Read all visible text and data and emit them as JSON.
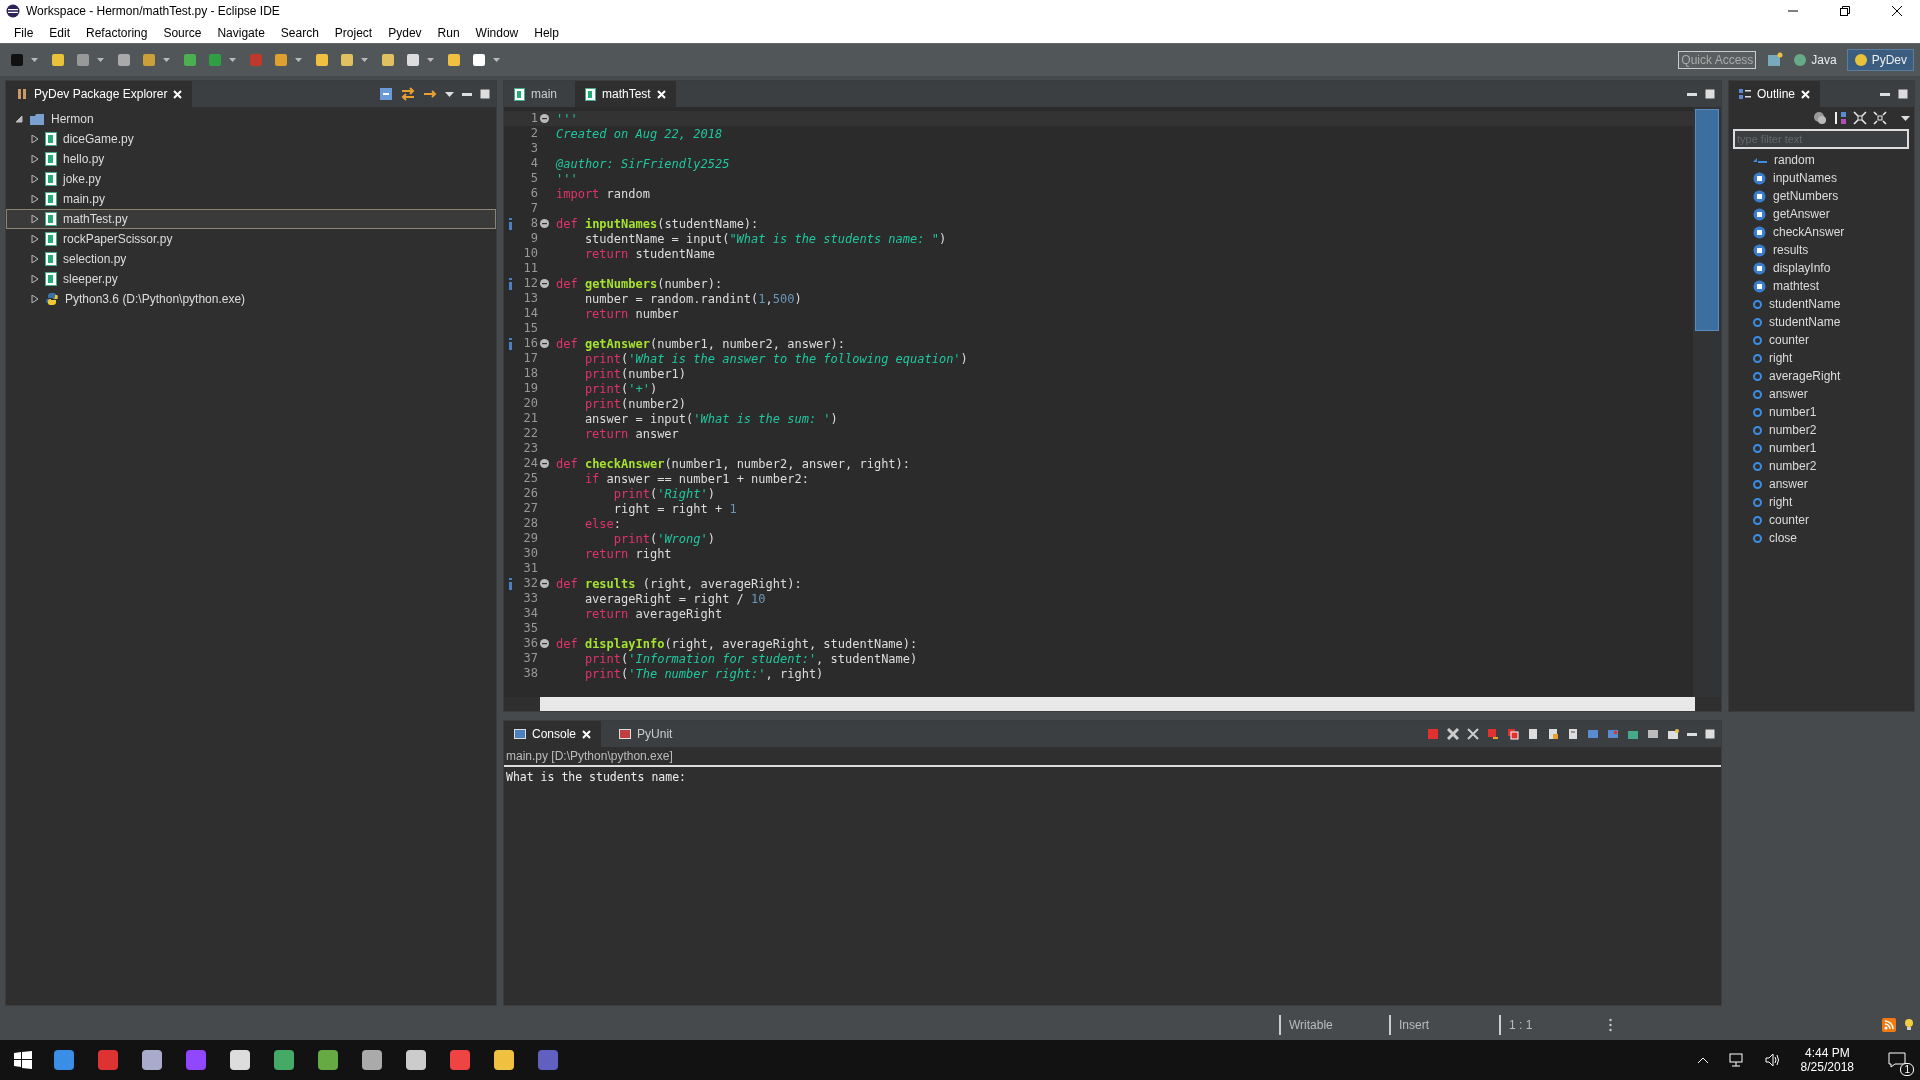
{
  "window": {
    "title": "Workspace - Hermon/mathTest.py - Eclipse IDE"
  },
  "menu": [
    "File",
    "Edit",
    "Refactoring",
    "Source",
    "Navigate",
    "Search",
    "Project",
    "Pydev",
    "Run",
    "Window",
    "Help"
  ],
  "toolbar": {
    "quick_access": {
      "placeholder": "Quick Access"
    },
    "perspectives": [
      {
        "label": "Java",
        "selected": false
      },
      {
        "label": "PyDev",
        "selected": true
      }
    ]
  },
  "explorer": {
    "title": "PyDev Package Explorer",
    "tree": [
      {
        "label": "Hermon",
        "kind": "project",
        "expanded": true,
        "selected": false,
        "children": [
          {
            "label": "diceGame.py",
            "kind": "file",
            "expanded": false,
            "selected": false
          },
          {
            "label": "hello.py",
            "kind": "file",
            "expanded": false,
            "selected": false
          },
          {
            "label": "joke.py",
            "kind": "file",
            "expanded": false,
            "selected": false
          },
          {
            "label": "main.py",
            "kind": "file",
            "expanded": false,
            "selected": false
          },
          {
            "label": "mathTest.py",
            "kind": "file",
            "expanded": false,
            "selected": true
          },
          {
            "label": "rockPaperScissor.py",
            "kind": "file",
            "expanded": false,
            "selected": false
          },
          {
            "label": "selection.py",
            "kind": "file",
            "expanded": false,
            "selected": false
          },
          {
            "label": "sleeper.py",
            "kind": "file",
            "expanded": false,
            "selected": false
          },
          {
            "label": "Python3.6  (D:\\Python\\python.exe)",
            "kind": "interpreter",
            "expanded": false,
            "selected": false
          }
        ]
      }
    ]
  },
  "editor": {
    "tabs": [
      {
        "label": "main",
        "selected": false
      },
      {
        "label": "mathTest",
        "selected": true
      }
    ],
    "lines": [
      {
        "number": "1",
        "info": false,
        "fold": true,
        "tokens": [
          {
            "kind": "str",
            "text": "'''"
          }
        ]
      },
      {
        "number": "2",
        "info": false,
        "fold": false,
        "tokens": [
          {
            "kind": "str",
            "text": "Created on Aug 22, 2018"
          }
        ]
      },
      {
        "number": "3",
        "info": false,
        "fold": false
      },
      {
        "number": "4",
        "info": false,
        "fold": false,
        "tokens": [
          {
            "kind": "str",
            "text": "@author: SirFriendly2525"
          }
        ]
      },
      {
        "number": "5",
        "info": false,
        "fold": false,
        "tokens": [
          {
            "kind": "str",
            "text": "'''"
          }
        ]
      },
      {
        "number": "6",
        "info": false,
        "fold": false,
        "tokens": [
          {
            "kind": "kw",
            "text": "import"
          },
          {
            "kind": "plain",
            "text": " random"
          }
        ]
      },
      {
        "number": "7",
        "info": false,
        "fold": false
      },
      {
        "number": "8",
        "info": true,
        "fold": true,
        "tokens": [
          {
            "kind": "kw",
            "text": "def "
          },
          {
            "kind": "fn",
            "text": "inputNames"
          },
          {
            "kind": "plain",
            "text": "(studentName):"
          }
        ]
      },
      {
        "number": "9",
        "info": false,
        "fold": false,
        "tokens": [
          {
            "kind": "plain",
            "text": "    studentName = input("
          },
          {
            "kind": "str",
            "text": "\"What is the students name: \""
          },
          {
            "kind": "plain",
            "text": ")"
          }
        ]
      },
      {
        "number": "10",
        "info": false,
        "fold": false,
        "tokens": [
          {
            "kind": "kw",
            "text": "    return"
          },
          {
            "kind": "plain",
            "text": " studentName"
          }
        ]
      },
      {
        "number": "11",
        "info": false,
        "fold": false
      },
      {
        "number": "12",
        "info": true,
        "fold": true,
        "tokens": [
          {
            "kind": "kw",
            "text": "def "
          },
          {
            "kind": "fn",
            "text": "getNumbers"
          },
          {
            "kind": "plain",
            "text": "(number):"
          }
        ]
      },
      {
        "number": "13",
        "info": false,
        "fold": false,
        "tokens": [
          {
            "kind": "plain",
            "text": "    number = random.randint("
          },
          {
            "kind": "num",
            "text": "1"
          },
          {
            "kind": "plain",
            "text": ","
          },
          {
            "kind": "num",
            "text": "500"
          },
          {
            "kind": "plain",
            "text": ")"
          }
        ]
      },
      {
        "number": "14",
        "info": false,
        "fold": false,
        "tokens": [
          {
            "kind": "kw",
            "text": "    return"
          },
          {
            "kind": "plain",
            "text": " number"
          }
        ]
      },
      {
        "number": "15",
        "info": false,
        "fold": false
      },
      {
        "number": "16",
        "info": true,
        "fold": true,
        "tokens": [
          {
            "kind": "kw",
            "text": "def "
          },
          {
            "kind": "fn",
            "text": "getAnswer"
          },
          {
            "kind": "plain",
            "text": "(number1, number2, answer):"
          }
        ]
      },
      {
        "number": "17",
        "info": false,
        "fold": false,
        "tokens": [
          {
            "kind": "kw",
            "text": "    print"
          },
          {
            "kind": "plain",
            "text": "("
          },
          {
            "kind": "str",
            "text": "'What is the answer to the following equation'"
          },
          {
            "kind": "plain",
            "text": ")"
          }
        ]
      },
      {
        "number": "18",
        "info": false,
        "fold": false,
        "tokens": [
          {
            "kind": "kw",
            "text": "    print"
          },
          {
            "kind": "plain",
            "text": "(number1)"
          }
        ]
      },
      {
        "number": "19",
        "info": false,
        "fold": false,
        "tokens": [
          {
            "kind": "kw",
            "text": "    print"
          },
          {
            "kind": "plain",
            "text": "("
          },
          {
            "kind": "str",
            "text": "'+'"
          },
          {
            "kind": "plain",
            "text": ")"
          }
        ]
      },
      {
        "number": "20",
        "info": false,
        "fold": false,
        "tokens": [
          {
            "kind": "kw",
            "text": "    print"
          },
          {
            "kind": "plain",
            "text": "(number2)"
          }
        ]
      },
      {
        "number": "21",
        "info": false,
        "fold": false,
        "tokens": [
          {
            "kind": "plain",
            "text": "    answer = input("
          },
          {
            "kind": "str",
            "text": "'What is the sum: '"
          },
          {
            "kind": "plain",
            "text": ")"
          }
        ]
      },
      {
        "number": "22",
        "info": false,
        "fold": false,
        "tokens": [
          {
            "kind": "kw",
            "text": "    return"
          },
          {
            "kind": "plain",
            "text": " answer"
          }
        ]
      },
      {
        "number": "23",
        "info": false,
        "fold": false
      },
      {
        "number": "24",
        "info": false,
        "fold": true,
        "tokens": [
          {
            "kind": "kw",
            "text": "def "
          },
          {
            "kind": "fn",
            "text": "checkAnswer"
          },
          {
            "kind": "plain",
            "text": "(number1, number2, answer, right):"
          }
        ]
      },
      {
        "number": "25",
        "info": false,
        "fold": false,
        "tokens": [
          {
            "kind": "kw",
            "text": "    if"
          },
          {
            "kind": "plain",
            "text": " answer == number1 + number2:"
          }
        ]
      },
      {
        "number": "26",
        "info": false,
        "fold": false,
        "tokens": [
          {
            "kind": "kw",
            "text": "        print"
          },
          {
            "kind": "plain",
            "text": "("
          },
          {
            "kind": "str",
            "text": "'Right'"
          },
          {
            "kind": "plain",
            "text": ")"
          }
        ]
      },
      {
        "number": "27",
        "info": false,
        "fold": false,
        "tokens": [
          {
            "kind": "plain",
            "text": "        right = right + "
          },
          {
            "kind": "num",
            "text": "1"
          }
        ]
      },
      {
        "number": "28",
        "info": false,
        "fold": false,
        "tokens": [
          {
            "kind": "kw",
            "text": "    else"
          },
          {
            "kind": "plain",
            "text": ":"
          }
        ]
      },
      {
        "number": "29",
        "info": false,
        "fold": false,
        "tokens": [
          {
            "kind": "kw",
            "text": "        print"
          },
          {
            "kind": "plain",
            "text": "("
          },
          {
            "kind": "str",
            "text": "'Wrong'"
          },
          {
            "kind": "plain",
            "text": ")"
          }
        ]
      },
      {
        "number": "30",
        "info": false,
        "fold": false,
        "tokens": [
          {
            "kind": "kw",
            "text": "    return"
          },
          {
            "kind": "plain",
            "text": " right"
          }
        ]
      },
      {
        "number": "31",
        "info": false,
        "fold": false
      },
      {
        "number": "32",
        "info": true,
        "fold": true,
        "tokens": [
          {
            "kind": "kw",
            "text": "def "
          },
          {
            "kind": "fn",
            "text": "results"
          },
          {
            "kind": "plain",
            "text": " (right, averageRight):"
          }
        ]
      },
      {
        "number": "33",
        "info": false,
        "fold": false,
        "tokens": [
          {
            "kind": "plain",
            "text": "    averageRight = right / "
          },
          {
            "kind": "num",
            "text": "10"
          }
        ]
      },
      {
        "number": "34",
        "info": false,
        "fold": false,
        "tokens": [
          {
            "kind": "kw",
            "text": "    return"
          },
          {
            "kind": "plain",
            "text": " averageRight"
          }
        ]
      },
      {
        "number": "35",
        "info": false,
        "fold": false
      },
      {
        "number": "36",
        "info": false,
        "fold": true,
        "tokens": [
          {
            "kind": "kw",
            "text": "def "
          },
          {
            "kind": "fn",
            "text": "displayInfo"
          },
          {
            "kind": "plain",
            "text": "(right, averageRight, studentName):"
          }
        ]
      },
      {
        "number": "37",
        "info": false,
        "fold": false,
        "tokens": [
          {
            "kind": "kw",
            "text": "    print"
          },
          {
            "kind": "plain",
            "text": "("
          },
          {
            "kind": "str",
            "text": "'Information for student:'"
          },
          {
            "kind": "plain",
            "text": ", studentName)"
          }
        ]
      },
      {
        "number": "38",
        "info": false,
        "fold": false,
        "tokens": [
          {
            "kind": "kw",
            "text": "    print"
          },
          {
            "kind": "plain",
            "text": "("
          },
          {
            "kind": "str",
            "text": "'The number right:'"
          },
          {
            "kind": "plain",
            "text": ", right)"
          }
        ]
      }
    ]
  },
  "outline": {
    "title": "Outline",
    "filter": {
      "placeholder": "type filter text"
    },
    "items": [
      {
        "label": "random",
        "kind": "import"
      },
      {
        "label": "inputNames",
        "kind": "method"
      },
      {
        "label": "getNumbers",
        "kind": "method"
      },
      {
        "label": "getAnswer",
        "kind": "method"
      },
      {
        "label": "checkAnswer",
        "kind": "method"
      },
      {
        "label": "results",
        "kind": "method"
      },
      {
        "label": "displayInfo",
        "kind": "method"
      },
      {
        "label": "mathtest",
        "kind": "method"
      },
      {
        "label": "studentName",
        "kind": "attribute"
      },
      {
        "label": "studentName",
        "kind": "attribute"
      },
      {
        "label": "counter",
        "kind": "attribute"
      },
      {
        "label": "right",
        "kind": "attribute"
      },
      {
        "label": "averageRight",
        "kind": "attribute"
      },
      {
        "label": "answer",
        "kind": "attribute"
      },
      {
        "label": "number1",
        "kind": "attribute"
      },
      {
        "label": "number2",
        "kind": "attribute"
      },
      {
        "label": "number1",
        "kind": "attribute"
      },
      {
        "label": "number2",
        "kind": "attribute"
      },
      {
        "label": "answer",
        "kind": "attribute"
      },
      {
        "label": "right",
        "kind": "attribute"
      },
      {
        "label": "counter",
        "kind": "attribute"
      },
      {
        "label": "close",
        "kind": "attribute"
      }
    ]
  },
  "console": {
    "tabs": [
      {
        "label": "Console",
        "selected": true
      },
      {
        "label": "PyUnit",
        "selected": false
      }
    ],
    "process": "main.py [D:\\Python\\python.exe]",
    "output": "What is the students name:"
  },
  "status_bar": {
    "items": [
      "Writable",
      "Insert",
      "1 : 1"
    ]
  },
  "taskbar": {
    "time": "4:44 PM",
    "date": "8/25/2018",
    "notifications": "1"
  }
}
